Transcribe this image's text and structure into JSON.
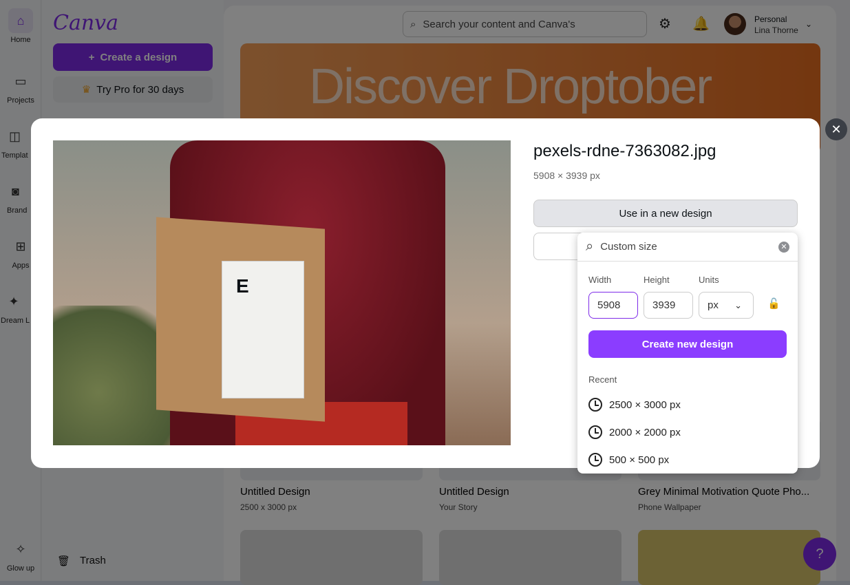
{
  "rail": [
    {
      "label": "Home",
      "icon": "home-icon"
    },
    {
      "label": "Projects",
      "icon": "folder-icon"
    },
    {
      "label": "Templat",
      "icon": "templates-icon"
    },
    {
      "label": "Brand",
      "icon": "brand-icon"
    },
    {
      "label": "Apps",
      "icon": "apps-icon"
    },
    {
      "label": "Dream L",
      "icon": "dream-lab-icon"
    },
    {
      "label": "Glow up",
      "icon": "glow-up-icon"
    }
  ],
  "side": {
    "logo": "Canva",
    "create": "Create a design",
    "trypro": "Try Pro for 30 days",
    "trash": "Trash"
  },
  "header": {
    "search_placeholder": "Search your content and Canva's",
    "account_type": "Personal",
    "user": "Lina Thorne"
  },
  "banner": {
    "text": "Discover Droptober"
  },
  "cards": [
    {
      "title": "Untitled Design",
      "sub": "2500 x 3000 px"
    },
    {
      "title": "Untitled Design",
      "sub": "Your Story"
    },
    {
      "title": "Grey Minimal Motivation Quote Pho...",
      "sub": "Phone Wallpaper"
    }
  ],
  "help": "?",
  "modal": {
    "filename": "pexels-rdne-7363082.jpg",
    "dimensions": "5908 × 3939 px",
    "use_button": "Use in a new design",
    "photo_label_letter": "E"
  },
  "popover": {
    "search_value": "Custom size",
    "width_label": "Width",
    "height_label": "Height",
    "units_label": "Units",
    "width": "5908",
    "height": "3939",
    "units": "px",
    "create": "Create new design",
    "recent_label": "Recent",
    "recent": [
      "2500 × 3000 px",
      "2000 × 2000 px",
      "500 × 500 px"
    ]
  },
  "colors": {
    "accent": "#8b3dff",
    "brand": "#7d2ae8"
  }
}
